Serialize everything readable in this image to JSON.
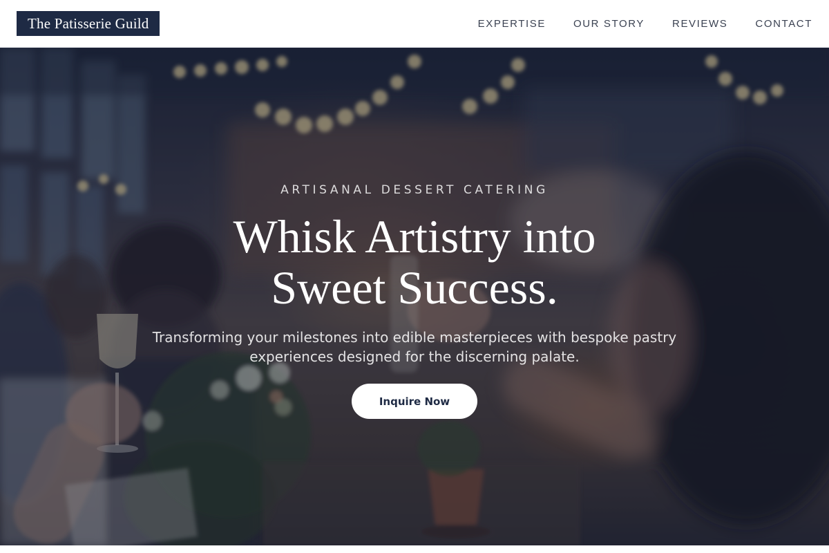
{
  "header": {
    "brand": "The Patisserie Guild",
    "nav": [
      {
        "label": "EXPERTISE"
      },
      {
        "label": "OUR STORY"
      },
      {
        "label": "REVIEWS"
      },
      {
        "label": "CONTACT"
      }
    ]
  },
  "hero": {
    "eyebrow": "ARTISANAL DESSERT CATERING",
    "headline_line1": "Whisk Artistry into",
    "headline_line2": "Sweet Success.",
    "subtitle_line1": "Transforming your milestones into edible masterpieces with bespoke pastry",
    "subtitle_line2": "experiences designed for the discerning palate.",
    "cta": "Inquire Now"
  },
  "colors": {
    "brand_bg": "#1e2a44",
    "nav_text": "#3b4252",
    "hero_overlay": "#141a30",
    "cta_bg": "#ffffff",
    "cta_text": "#1e2a44"
  }
}
